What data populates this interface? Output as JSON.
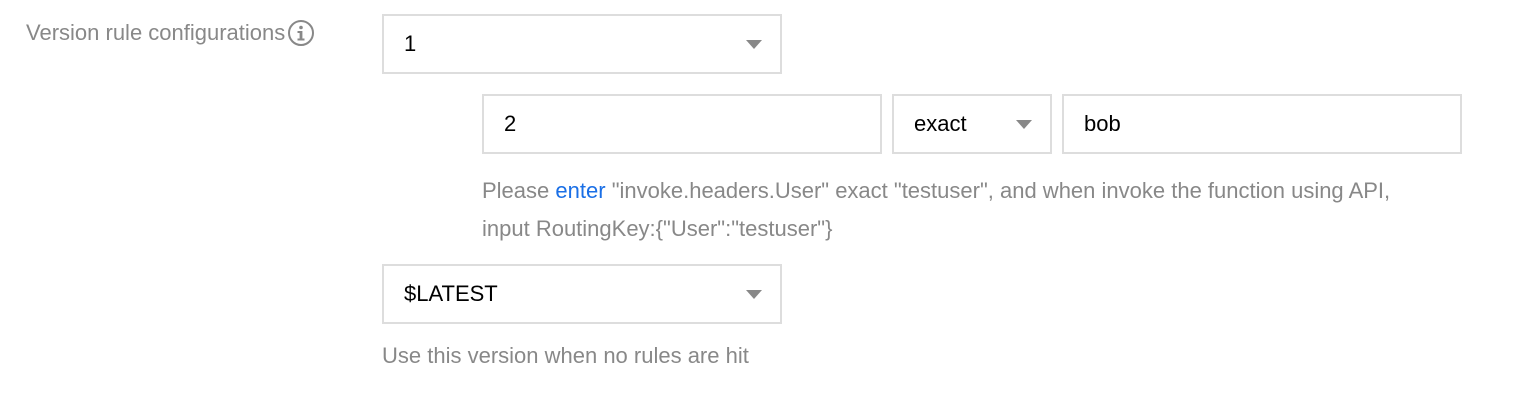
{
  "form": {
    "label": "Version rule configurations",
    "info_icon": "info-icon",
    "version_select": {
      "value": "1",
      "icon": "chevron-down-icon"
    },
    "rule": {
      "key_value": "2",
      "match_select": {
        "value": "exact",
        "icon": "chevron-down-icon"
      },
      "match_value": "bob"
    },
    "help": {
      "prefix": "Please",
      "link": "enter",
      "line1_rest": "\"invoke.headers.User\" exact \"testuser\", and when invoke the function using API,",
      "line2": "input RoutingKey:{\"User\":\"testuser\"}"
    },
    "default_version_select": {
      "value": "$LATEST",
      "icon": "chevron-down-icon"
    },
    "default_hint": "Use this version when no rules are hit"
  },
  "colors": {
    "label_gray": "#888888",
    "border": "#dddddd",
    "link_blue": "#1a6fe6"
  }
}
